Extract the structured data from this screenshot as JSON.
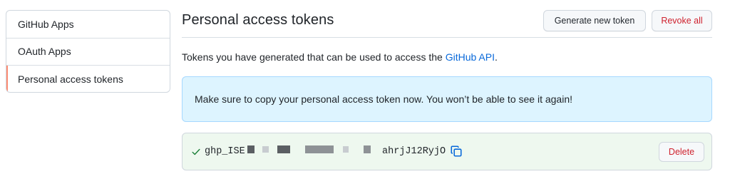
{
  "sidebar": {
    "items": [
      {
        "label": "GitHub Apps"
      },
      {
        "label": "OAuth Apps"
      },
      {
        "label": "Personal access tokens",
        "active": true
      }
    ]
  },
  "header": {
    "title": "Personal access tokens",
    "generate_label": "Generate new token",
    "revoke_label": "Revoke all"
  },
  "description": {
    "text": "Tokens you have generated that can be used to access the ",
    "link": "GitHub API",
    "suffix": "."
  },
  "flash": {
    "message": "Make sure to copy your personal access token now. You won’t be able to see it again!"
  },
  "token": {
    "prefix": "ghp_ISE",
    "suffix": "ahrjJ12RyjO",
    "delete_label": "Delete",
    "check_icon": "check-icon",
    "copy_icon": "copy-icon"
  },
  "colors": {
    "accent": "#fd8c73",
    "link": "#0969da",
    "danger": "#cf222e",
    "flash_bg": "#ddf4ff",
    "token_bg": "#eef8ef",
    "success": "#1a7f37"
  }
}
